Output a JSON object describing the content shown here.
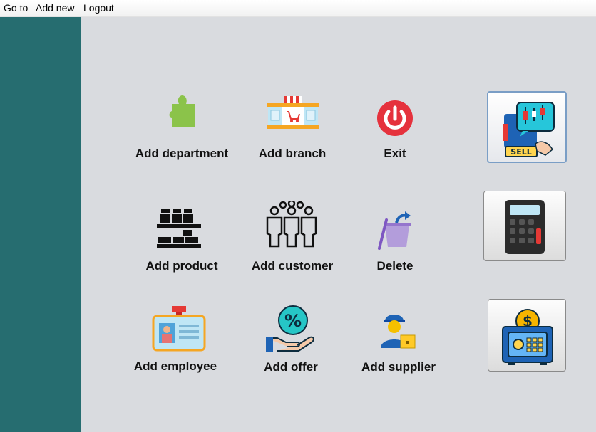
{
  "menubar": {
    "goto_label": "Go to",
    "addnew_label": "Add new",
    "logout_label": "Logout"
  },
  "tiles": {
    "add_department": "Add department",
    "add_branch": "Add branch",
    "exit": "Exit",
    "add_product": "Add product",
    "add_customer": "Add customer",
    "delete": "Delete",
    "add_employee": "Add employee",
    "add_offer": "Add offer",
    "add_supplier": "Add supplier"
  },
  "side_buttons": {
    "sell_sign_text": "SELL"
  },
  "colors": {
    "sidebar": "#266d70",
    "background": "#d9dbdf"
  }
}
